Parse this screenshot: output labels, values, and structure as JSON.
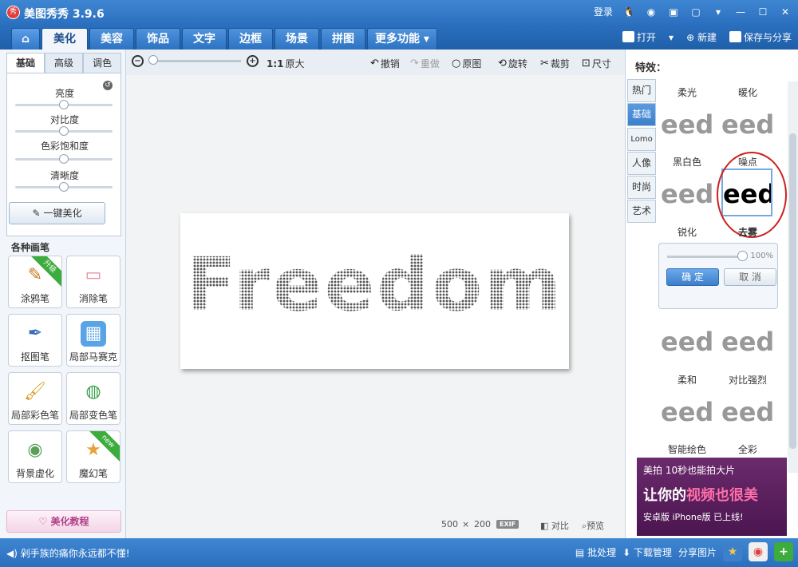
{
  "app": {
    "title": "美图秀秀 3.9.6",
    "logo_text": "秀"
  },
  "titlebar": {
    "login_label": "登录"
  },
  "menu": {
    "tabs": [
      "美化",
      "美容",
      "饰品",
      "文字",
      "边框",
      "场景",
      "拼图",
      "更多功能"
    ],
    "active_tab": "美化",
    "open_label": "打开",
    "new_label": "新建",
    "save_label": "保存与分享"
  },
  "left": {
    "subtabs": [
      "基础",
      "高级",
      "调色"
    ],
    "active_subtab": "基础",
    "sliders": [
      {
        "label": "亮度",
        "value": 0.5
      },
      {
        "label": "对比度",
        "value": 0.5
      },
      {
        "label": "色彩饱和度",
        "value": 0.5
      },
      {
        "label": "清晰度",
        "value": 0.5
      }
    ],
    "onekey_label": "一键美化",
    "brushes_title": "各种画笔",
    "brushes": [
      {
        "name": "涂鸦笔",
        "icon": "graffiti-brush-icon",
        "badge": "升级"
      },
      {
        "name": "消除笔",
        "icon": "eraser-icon",
        "badge": ""
      },
      {
        "name": "抠图笔",
        "icon": "cutout-pen-icon",
        "badge": ""
      },
      {
        "name": "局部马赛克",
        "icon": "mosaic-icon",
        "badge": ""
      },
      {
        "name": "局部彩色笔",
        "icon": "color-brush-icon",
        "badge": ""
      },
      {
        "name": "局部变色笔",
        "icon": "recolor-bucket-icon",
        "badge": ""
      },
      {
        "name": "背景虚化",
        "icon": "blur-background-icon",
        "badge": ""
      },
      {
        "name": "魔幻笔",
        "icon": "magic-wand-icon",
        "badge": "new"
      }
    ],
    "tutorial_label": "美化教程"
  },
  "toolbar": {
    "ratio_label": "1:1",
    "original_size_label": "原大",
    "undo_label": "撤销",
    "redo_label": "重做",
    "original_label": "原图",
    "rotate_label": "旋转",
    "crop_label": "裁剪",
    "size_label": "尺寸",
    "zoom_level": 0.05
  },
  "canvas": {
    "image_text": "Freedom",
    "width_value": "500",
    "times": "×",
    "height_value": "200",
    "exif_label": "EXIF",
    "compare_label": "对比",
    "preview_label": "预览"
  },
  "right": {
    "title": "特效：",
    "categories": [
      "热门",
      "基础",
      "Lomo",
      "人像",
      "时尚",
      "艺术"
    ],
    "active_category": "基础",
    "thumb_text": "eedc",
    "effects": [
      "柔光",
      "暖化",
      "黑白色",
      "噪点",
      "锐化",
      "去雾",
      "柔和",
      "对比强烈",
      "智能绘色",
      "全彩"
    ],
    "selected_effect": "去雾",
    "strength_value": "100%",
    "strength_level": 1.0,
    "confirm_label": "确 定",
    "cancel_label": "取 消",
    "ad": {
      "line1": "美拍 10秒也能拍大片",
      "line2_a": "让你的",
      "line2_b": "视频也很美",
      "line3": "安卓版 iPhone版 已上线!"
    }
  },
  "status": {
    "message": "剁手族的痛你永远都不懂!",
    "batch_label": "批处理",
    "download_label": "下载管理",
    "share_label": "分享图片"
  },
  "colors": {
    "title_blue": "#2a6fbe",
    "selection_red": "#cc2020",
    "accent_green": "#3cac3c"
  }
}
